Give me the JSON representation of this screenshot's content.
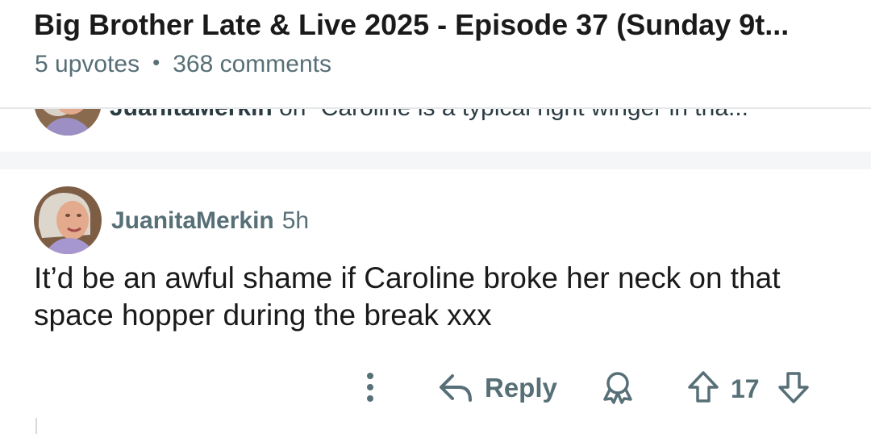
{
  "post": {
    "title": "Big Brother Late & Live 2025 - Episode 37 (Sunday 9t...",
    "upvotes": "5 upvotes",
    "separator": "•",
    "comments": "368 comments"
  },
  "previous_comment": {
    "author": "JuanitaMerkin",
    "text": "on “Caroline is a typical right winger in tha..."
  },
  "comment": {
    "author": "JuanitaMerkin",
    "time": "5h",
    "body": "It’d be an awful shame if Caroline broke her neck on that space hopper during the break xxx",
    "actions": {
      "more_icon": "more-vertical-icon",
      "reply_label": "Reply",
      "award_icon": "award-icon",
      "upvote_icon": "upvote-arrow-icon",
      "score": "17",
      "downvote_icon": "downvote-arrow-icon"
    }
  },
  "colors": {
    "text_primary": "#1a1a1b",
    "text_secondary": "#576f76",
    "divider": "#e6e8ea",
    "gap_background": "#f5f6f7"
  }
}
